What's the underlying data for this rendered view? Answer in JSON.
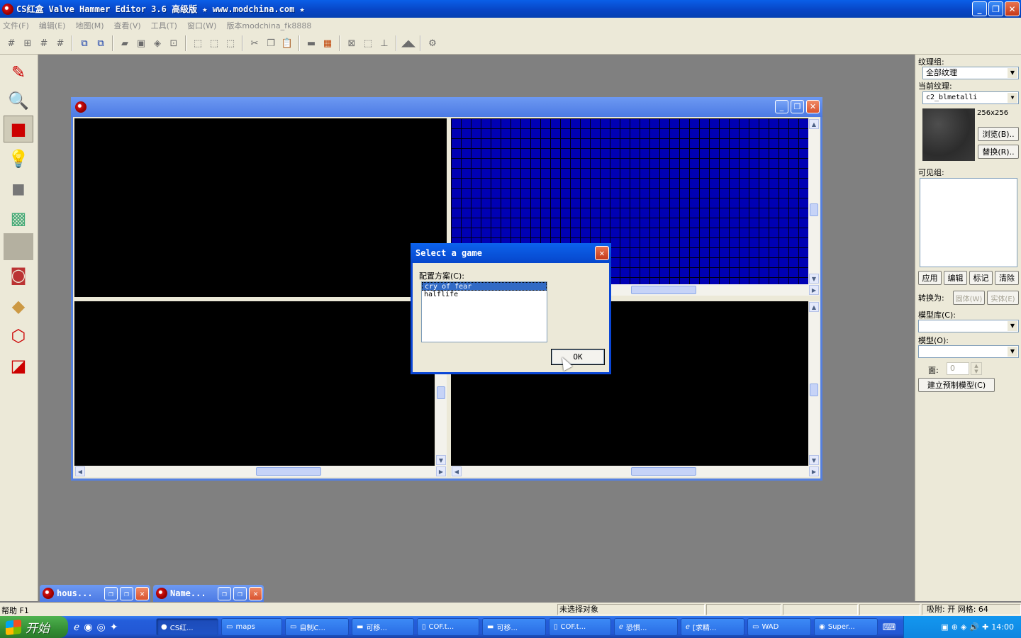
{
  "app": {
    "title": "CS红盒 Valve Hammer Editor 3.6 高级版 ★ www.modchina.com ★",
    "min": "_",
    "max": "❐",
    "close": "✕"
  },
  "menu": [
    "文件(F)",
    "编辑(E)",
    "地图(M)",
    "查看(V)",
    "工具(T)",
    "窗口(W)",
    "版本modchina_fk8888"
  ],
  "right_panel": {
    "texture_group_label": "纹理组:",
    "texture_group_value": "全部纹理",
    "current_texture_label": "当前纹理:",
    "current_texture_value": "c2_blmetalli",
    "texture_size": "256x256",
    "browse_button": "浏览(B)..",
    "replace_button": "替换(R)..",
    "visgroup_label": "可见组:",
    "apply_button": "应用",
    "edit_button": "编辑",
    "mark_button": "标记",
    "clear_button": "清除",
    "convert_label": "转换为:",
    "to_world_button": "固体(W)",
    "to_entity_button": "实体(E)",
    "prefab_lib_label": "模型库(C):",
    "prefab_label": "模型(O):",
    "faces_label": "面:",
    "faces_value": "0",
    "create_prefab_button": "建立预制模型(C)"
  },
  "dialog": {
    "title": "Select a game",
    "config_label": "配置方案(C):",
    "items": [
      "cry of fear",
      "halflife"
    ],
    "ok": "OK"
  },
  "minimized_windows": [
    "hous...",
    "Name..."
  ],
  "status": {
    "help": "帮助 F1",
    "selection": "未选择对象",
    "snap": "吸附: 开 网格: 64"
  },
  "taskbar": {
    "start": "开始",
    "tasks": [
      "CS红...",
      "maps",
      "自制C...",
      "可移...",
      "COF.t...",
      "可移...",
      "COF.t...",
      "恐惧...",
      "[求精...",
      "WAD",
      "Super..."
    ],
    "clock": "14:00"
  }
}
